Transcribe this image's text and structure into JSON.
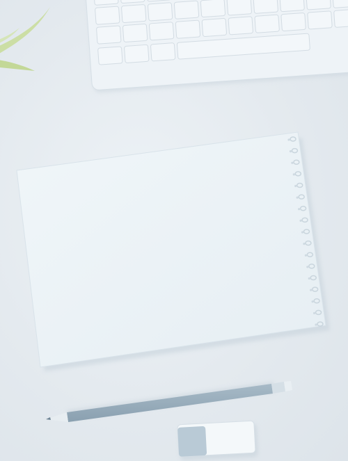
{
  "scene": {
    "objects": [
      "plant",
      "keyboard",
      "spiral-notebook",
      "pencil",
      "eraser"
    ],
    "colors": {
      "background": "#e4eaef",
      "keyboard_body": "#eef3f7",
      "key": "#f3f7fa",
      "notebook_page": "#ecf3f7",
      "spiral": "#c9d5dd",
      "pencil_body": "#93a9b8",
      "eraser": "#b9cad6",
      "plant": "#c6dc95"
    }
  }
}
